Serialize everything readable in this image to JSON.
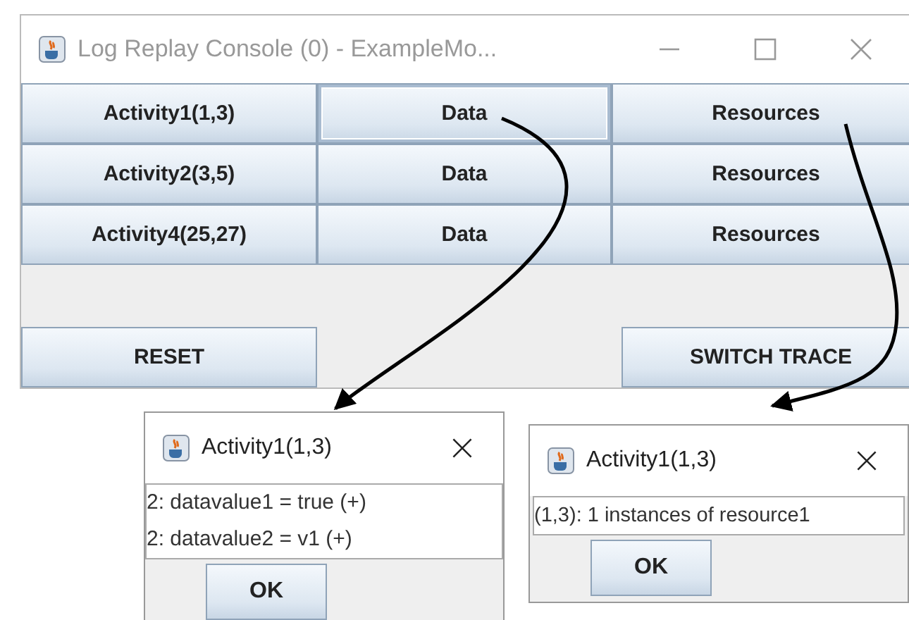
{
  "main_window": {
    "title": "Log Replay Console (0) - ExampleMo...",
    "activities": [
      {
        "name": "Activity1(1,3)",
        "data": "Data",
        "resources": "Resources"
      },
      {
        "name": "Activity2(3,5)",
        "data": "Data",
        "resources": "Resources"
      },
      {
        "name": "Activity4(25,27)",
        "data": "Data",
        "resources": "Resources"
      }
    ],
    "buttons": [
      "RESET",
      "SWITCH TRACE"
    ]
  },
  "dialogs": [
    {
      "title": "Activity1(1,3)",
      "lines": [
        "2: datavalue1 = true (+)",
        "2: datavalue2 = v1 (+)"
      ],
      "button": "OK"
    },
    {
      "title": "Activity1(1,3)",
      "lines": [
        "(1,3): 1 instances of resource1"
      ],
      "button": "OK"
    }
  ]
}
